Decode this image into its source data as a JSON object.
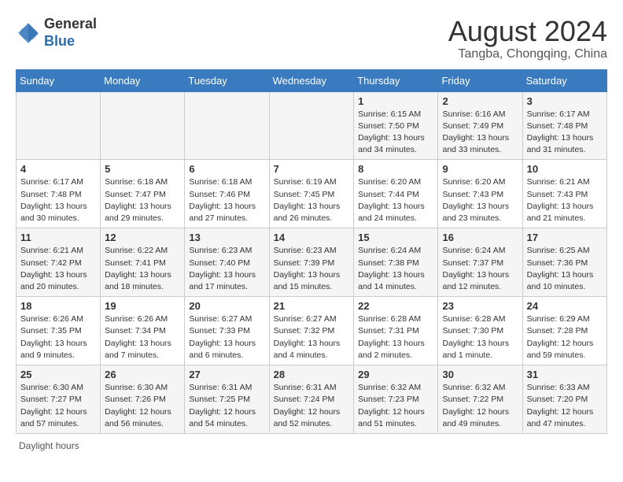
{
  "header": {
    "logo_general": "General",
    "logo_blue": "Blue",
    "title": "August 2024",
    "location": "Tangba, Chongqing, China"
  },
  "days_of_week": [
    "Sunday",
    "Monday",
    "Tuesday",
    "Wednesday",
    "Thursday",
    "Friday",
    "Saturday"
  ],
  "weeks": [
    [
      {
        "day": "",
        "detail": ""
      },
      {
        "day": "",
        "detail": ""
      },
      {
        "day": "",
        "detail": ""
      },
      {
        "day": "",
        "detail": ""
      },
      {
        "day": "1",
        "detail": "Sunrise: 6:15 AM\nSunset: 7:50 PM\nDaylight: 13 hours\nand 34 minutes."
      },
      {
        "day": "2",
        "detail": "Sunrise: 6:16 AM\nSunset: 7:49 PM\nDaylight: 13 hours\nand 33 minutes."
      },
      {
        "day": "3",
        "detail": "Sunrise: 6:17 AM\nSunset: 7:48 PM\nDaylight: 13 hours\nand 31 minutes."
      }
    ],
    [
      {
        "day": "4",
        "detail": "Sunrise: 6:17 AM\nSunset: 7:48 PM\nDaylight: 13 hours\nand 30 minutes."
      },
      {
        "day": "5",
        "detail": "Sunrise: 6:18 AM\nSunset: 7:47 PM\nDaylight: 13 hours\nand 29 minutes."
      },
      {
        "day": "6",
        "detail": "Sunrise: 6:18 AM\nSunset: 7:46 PM\nDaylight: 13 hours\nand 27 minutes."
      },
      {
        "day": "7",
        "detail": "Sunrise: 6:19 AM\nSunset: 7:45 PM\nDaylight: 13 hours\nand 26 minutes."
      },
      {
        "day": "8",
        "detail": "Sunrise: 6:20 AM\nSunset: 7:44 PM\nDaylight: 13 hours\nand 24 minutes."
      },
      {
        "day": "9",
        "detail": "Sunrise: 6:20 AM\nSunset: 7:43 PM\nDaylight: 13 hours\nand 23 minutes."
      },
      {
        "day": "10",
        "detail": "Sunrise: 6:21 AM\nSunset: 7:43 PM\nDaylight: 13 hours\nand 21 minutes."
      }
    ],
    [
      {
        "day": "11",
        "detail": "Sunrise: 6:21 AM\nSunset: 7:42 PM\nDaylight: 13 hours\nand 20 minutes."
      },
      {
        "day": "12",
        "detail": "Sunrise: 6:22 AM\nSunset: 7:41 PM\nDaylight: 13 hours\nand 18 minutes."
      },
      {
        "day": "13",
        "detail": "Sunrise: 6:23 AM\nSunset: 7:40 PM\nDaylight: 13 hours\nand 17 minutes."
      },
      {
        "day": "14",
        "detail": "Sunrise: 6:23 AM\nSunset: 7:39 PM\nDaylight: 13 hours\nand 15 minutes."
      },
      {
        "day": "15",
        "detail": "Sunrise: 6:24 AM\nSunset: 7:38 PM\nDaylight: 13 hours\nand 14 minutes."
      },
      {
        "day": "16",
        "detail": "Sunrise: 6:24 AM\nSunset: 7:37 PM\nDaylight: 13 hours\nand 12 minutes."
      },
      {
        "day": "17",
        "detail": "Sunrise: 6:25 AM\nSunset: 7:36 PM\nDaylight: 13 hours\nand 10 minutes."
      }
    ],
    [
      {
        "day": "18",
        "detail": "Sunrise: 6:26 AM\nSunset: 7:35 PM\nDaylight: 13 hours\nand 9 minutes."
      },
      {
        "day": "19",
        "detail": "Sunrise: 6:26 AM\nSunset: 7:34 PM\nDaylight: 13 hours\nand 7 minutes."
      },
      {
        "day": "20",
        "detail": "Sunrise: 6:27 AM\nSunset: 7:33 PM\nDaylight: 13 hours\nand 6 minutes."
      },
      {
        "day": "21",
        "detail": "Sunrise: 6:27 AM\nSunset: 7:32 PM\nDaylight: 13 hours\nand 4 minutes."
      },
      {
        "day": "22",
        "detail": "Sunrise: 6:28 AM\nSunset: 7:31 PM\nDaylight: 13 hours\nand 2 minutes."
      },
      {
        "day": "23",
        "detail": "Sunrise: 6:28 AM\nSunset: 7:30 PM\nDaylight: 13 hours\nand 1 minute."
      },
      {
        "day": "24",
        "detail": "Sunrise: 6:29 AM\nSunset: 7:28 PM\nDaylight: 12 hours\nand 59 minutes."
      }
    ],
    [
      {
        "day": "25",
        "detail": "Sunrise: 6:30 AM\nSunset: 7:27 PM\nDaylight: 12 hours\nand 57 minutes."
      },
      {
        "day": "26",
        "detail": "Sunrise: 6:30 AM\nSunset: 7:26 PM\nDaylight: 12 hours\nand 56 minutes."
      },
      {
        "day": "27",
        "detail": "Sunrise: 6:31 AM\nSunset: 7:25 PM\nDaylight: 12 hours\nand 54 minutes."
      },
      {
        "day": "28",
        "detail": "Sunrise: 6:31 AM\nSunset: 7:24 PM\nDaylight: 12 hours\nand 52 minutes."
      },
      {
        "day": "29",
        "detail": "Sunrise: 6:32 AM\nSunset: 7:23 PM\nDaylight: 12 hours\nand 51 minutes."
      },
      {
        "day": "30",
        "detail": "Sunrise: 6:32 AM\nSunset: 7:22 PM\nDaylight: 12 hours\nand 49 minutes."
      },
      {
        "day": "31",
        "detail": "Sunrise: 6:33 AM\nSunset: 7:20 PM\nDaylight: 12 hours\nand 47 minutes."
      }
    ]
  ],
  "footer": {
    "daylight_hours_label": "Daylight hours"
  }
}
